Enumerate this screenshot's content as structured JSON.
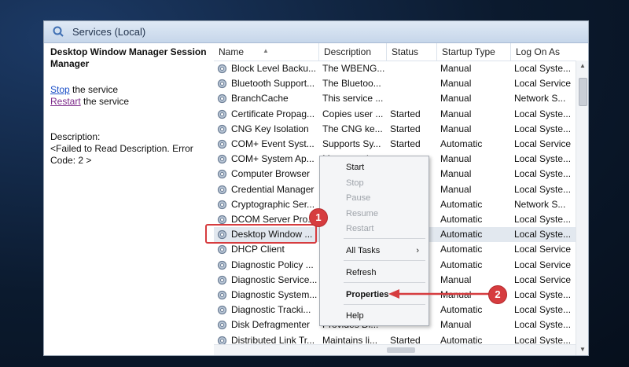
{
  "window": {
    "title": "Services (Local)"
  },
  "left_pane": {
    "heading": "Desktop Window Manager Session Manager",
    "stop_link": "Stop",
    "stop_suffix": " the service",
    "restart_link": "Restart",
    "restart_suffix": " the service",
    "description_label": "Description:",
    "description_text": "<Failed to Read Description. Error Code: 2 >"
  },
  "columns": [
    "Name",
    "Description",
    "Status",
    "Startup Type",
    "Log On As"
  ],
  "rows": [
    {
      "name": "Block Level Backu...",
      "description": "The WBENG...",
      "status": "",
      "startup": "Manual",
      "logon": "Local Syste..."
    },
    {
      "name": "Bluetooth Support...",
      "description": "The Bluetoo...",
      "status": "",
      "startup": "Manual",
      "logon": "Local Service"
    },
    {
      "name": "BranchCache",
      "description": "This service ...",
      "status": "",
      "startup": "Manual",
      "logon": "Network S..."
    },
    {
      "name": "Certificate Propag...",
      "description": "Copies user ...",
      "status": "Started",
      "startup": "Manual",
      "logon": "Local Syste..."
    },
    {
      "name": "CNG Key Isolation",
      "description": "The CNG ke...",
      "status": "Started",
      "startup": "Manual",
      "logon": "Local Syste..."
    },
    {
      "name": "COM+ Event Syst...",
      "description": "Supports Sy...",
      "status": "Started",
      "startup": "Automatic",
      "logon": "Local Service"
    },
    {
      "name": "COM+ System Ap...",
      "description": "Manages th...",
      "status": "",
      "startup": "Manual",
      "logon": "Local Syste..."
    },
    {
      "name": "Computer Browser",
      "description": "",
      "status": "",
      "startup": "Manual",
      "logon": "Local Syste..."
    },
    {
      "name": "Credential Manager",
      "description": "",
      "status": "",
      "startup": "Manual",
      "logon": "Local Syste..."
    },
    {
      "name": "Cryptographic Ser...",
      "description": "",
      "status": "",
      "startup": "Automatic",
      "logon": "Network S..."
    },
    {
      "name": "DCOM Server Pro...",
      "description": "",
      "status": "",
      "startup": "Automatic",
      "logon": "Local Syste..."
    },
    {
      "name": "Desktop Window ...",
      "description": "",
      "status": "",
      "startup": "Automatic",
      "logon": "Local Syste..."
    },
    {
      "name": "DHCP Client",
      "description": "",
      "status": "",
      "startup": "Automatic",
      "logon": "Local Service"
    },
    {
      "name": "Diagnostic Policy ...",
      "description": "",
      "status": "",
      "startup": "Automatic",
      "logon": "Local Service"
    },
    {
      "name": "Diagnostic Service...",
      "description": "",
      "status": "",
      "startup": "Manual",
      "logon": "Local Service"
    },
    {
      "name": "Diagnostic System...",
      "description": "",
      "status": "",
      "startup": "Manual",
      "logon": "Local Syste..."
    },
    {
      "name": "Diagnostic Tracki...",
      "description": "",
      "status": "",
      "startup": "Automatic",
      "logon": "Local Syste..."
    },
    {
      "name": "Disk Defragmenter",
      "description": "Provides Di...",
      "status": "",
      "startup": "Manual",
      "logon": "Local Syste..."
    },
    {
      "name": "Distributed Link Tr...",
      "description": "Maintains li...",
      "status": "Started",
      "startup": "Automatic",
      "logon": "Local Syste..."
    }
  ],
  "context_menu": {
    "start": "Start",
    "stop": "Stop",
    "pause": "Pause",
    "resume": "Resume",
    "restart": "Restart",
    "all_tasks": "All Tasks",
    "all_tasks_chevron": "›",
    "refresh": "Refresh",
    "properties": "Properties",
    "help": "Help"
  },
  "annotations": {
    "badge1": "1",
    "badge2": "2"
  },
  "colors": {
    "accent": "#d63c3f",
    "link": "#1b4fc7",
    "selected_row": "#e2e8ef"
  },
  "icons": {
    "title": "services-gear-icon",
    "row": "service-gear-icon"
  }
}
